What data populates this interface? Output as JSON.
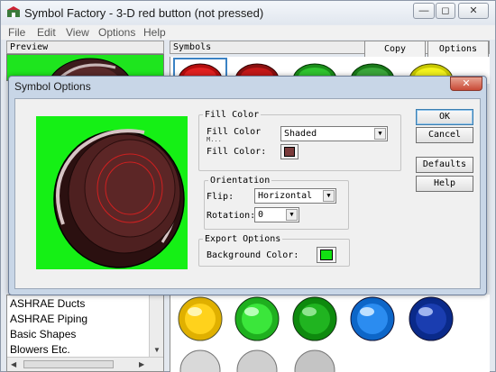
{
  "window": {
    "title": "Symbol Factory - 3-D red button (not pressed)"
  },
  "menu": [
    "File",
    "Edit",
    "View",
    "Options",
    "Help"
  ],
  "caption_buttons": {
    "minimize": "—",
    "maximize": "◻",
    "close": "✕"
  },
  "panels": {
    "preview_header": "Preview",
    "symbols_header": "Symbols"
  },
  "toolbar": {
    "copy": "Copy",
    "options": "Options"
  },
  "categories": [
    "ASHRAE Ducts",
    "ASHRAE Piping",
    "Basic Shapes",
    "Blowers Etc."
  ],
  "dialog": {
    "title": "Symbol Options",
    "close": "✕",
    "fill_color": {
      "legend": "Fill Color",
      "mode_label": "Fill Color",
      "mode_label_partial": "M...",
      "mode_value": "Shaded",
      "color_label": "Fill Color:",
      "color": "#7a3b3b"
    },
    "orientation": {
      "legend": "Orientation",
      "flip_label": "Flip:",
      "flip_value": "Horizontal",
      "rotation_label": "Rotation:",
      "rotation_value": "0"
    },
    "export": {
      "legend": "Export Options",
      "bg_label": "Background Color:",
      "bg_color": "#12e012"
    },
    "buttons": {
      "ok": "OK",
      "cancel": "Cancel",
      "defaults": "Defaults",
      "help": "Help"
    }
  },
  "colors": {
    "accent_green": "#15f015",
    "button_body": "#4a2222"
  }
}
